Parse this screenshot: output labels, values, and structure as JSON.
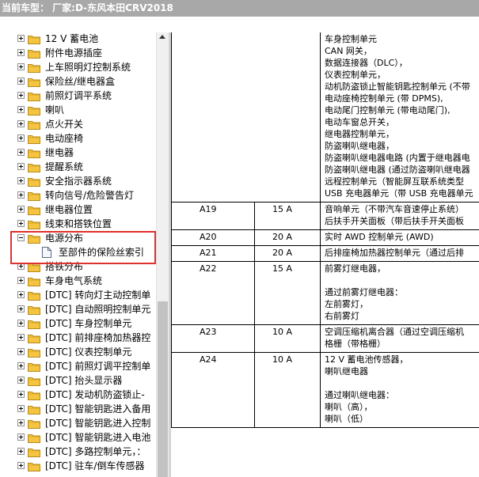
{
  "title": "当前车型：  厂家:D-东风本田CRV2018",
  "colors": {
    "folder": "#f5c542",
    "highlight": "#e0312c",
    "titlebar": "#a8a8a8"
  },
  "tree": [
    {
      "label": "12 V 蓄电池",
      "expand": "plus"
    },
    {
      "label": "附件电源插座",
      "expand": "plus"
    },
    {
      "label": "上车照明灯控制系统",
      "expand": "plus"
    },
    {
      "label": "保险丝/继电器盒",
      "expand": "plus"
    },
    {
      "label": "前照灯调平系统",
      "expand": "plus"
    },
    {
      "label": "喇叭",
      "expand": "plus"
    },
    {
      "label": "点火开关",
      "expand": "plus"
    },
    {
      "label": "电动座椅",
      "expand": "plus"
    },
    {
      "label": "继电器",
      "expand": "plus"
    },
    {
      "label": "提醒系统",
      "expand": "plus"
    },
    {
      "label": "安全指示器系统",
      "expand": "plus"
    },
    {
      "label": "转向信号/危险警告灯",
      "expand": "plus"
    },
    {
      "label": "继电器位置",
      "expand": "plus"
    },
    {
      "label": "线束和搭铁位置",
      "expand": "plus"
    },
    {
      "label": "电源分布",
      "expand": "minus"
    },
    {
      "label": "至部件的保险丝索引",
      "expand": "doc"
    },
    {
      "label": "搭铁分布",
      "expand": "plus"
    },
    {
      "label": "车身电气系统",
      "expand": "plus"
    },
    {
      "label": "[DTC] 转向灯主动控制单",
      "expand": "plus"
    },
    {
      "label": "[DTC] 自动照明控制单元",
      "expand": "plus"
    },
    {
      "label": "[DTC] 车身控制单元",
      "expand": "plus"
    },
    {
      "label": "[DTC] 前排座椅加热器控",
      "expand": "plus"
    },
    {
      "label": "[DTC] 仪表控制单元",
      "expand": "plus"
    },
    {
      "label": "[DTC] 前照灯调平控制单",
      "expand": "plus"
    },
    {
      "label": "[DTC] 抬头显示器",
      "expand": "plus"
    },
    {
      "label": "[DTC] 发动机防盗锁止-",
      "expand": "plus"
    },
    {
      "label": "[DTC] 智能钥匙进入备用",
      "expand": "plus"
    },
    {
      "label": "[DTC] 智能钥匙进入控制",
      "expand": "plus"
    },
    {
      "label": "[DTC] 智能钥匙进入电池",
      "expand": "plus"
    },
    {
      "label": "[DTC] 多路控制单元，：",
      "expand": "plus"
    },
    {
      "label": "[DTC] 驻车/倒车传感器",
      "expand": "plus"
    }
  ],
  "table": {
    "top_block": [
      "车身控制单元",
      "CAN 网关，",
      "数据连接器（DLC），",
      "仪表控制单元，",
      "动机防盗锁止智能钥匙控制单元 (不带",
      "电动座椅控制单元 (带 DPMS),",
      "电动尾门控制单元 (带电动尾门),",
      "电动车窗总开关，",
      "继电器控制单元，",
      "防盗喇叭继电器，",
      "防盗喇叭继电器电路 (内置于继电器电",
      "防盗喇叭继电器 (通过防盗喇叭继电器",
      "远程控制单元（智能屏互联系统类型",
      "USB 充电器单元（带 USB 充电器单元"
    ],
    "rows": [
      {
        "id": "A19",
        "amp": "15 A",
        "desc": [
          "音响单元（不带汽车音速停止系统）",
          "后扶手开关面板（带后扶手开关面板"
        ]
      },
      {
        "id": "A20",
        "amp": "20 A",
        "desc": [
          "实时 AWD 控制单元 (AWD)"
        ]
      },
      {
        "id": "A21",
        "amp": "20 A",
        "desc": [
          "后排座椅加热器控制单元（通过后排"
        ]
      },
      {
        "id": "A22",
        "amp": "15 A",
        "desc": [
          "前雾灯继电器，",
          "",
          "通过前雾灯继电器：",
          "左前雾灯，",
          "右前雾灯"
        ]
      },
      {
        "id": "A23",
        "amp": "10 A",
        "desc": [
          "空调压缩机离合器（通过空调压缩机",
          "格栅（带格栅）"
        ]
      },
      {
        "id": "A24",
        "amp": "10 A",
        "desc": [
          "12 V 蓄电池传感器，",
          "喇叭继电器",
          "",
          "通过喇叭继电器：",
          "喇叭（高），",
          "喇叭（低）"
        ]
      }
    ]
  }
}
